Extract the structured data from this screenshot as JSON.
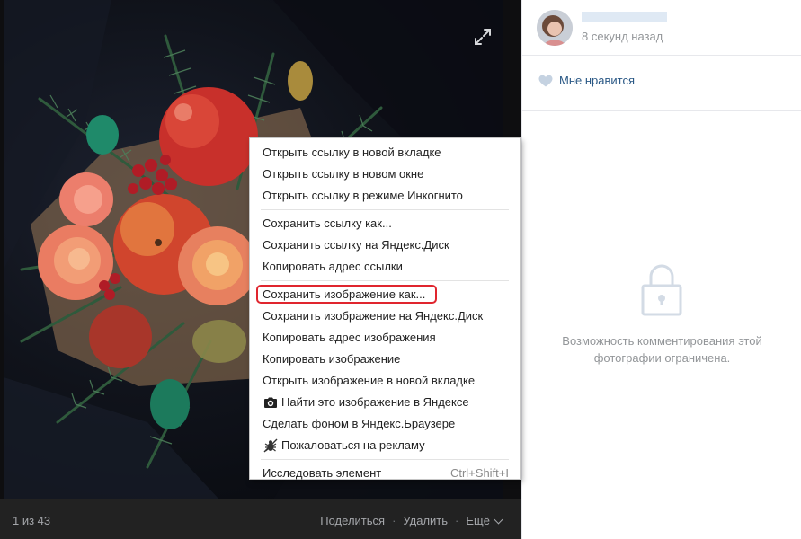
{
  "viewer": {
    "counter": "1 из 43",
    "actions": {
      "share": "Поделиться",
      "delete": "Удалить",
      "more": "Ещё"
    },
    "expand_icon": "expand-icon"
  },
  "side": {
    "author_time": "8 секунд назад",
    "like_label": "Мне нравится",
    "comments_closed_text": "Возможность комментирования этой фотографии ограничена."
  },
  "context_menu": {
    "items": [
      {
        "label": "Открыть ссылку в новой вкладке"
      },
      {
        "label": "Открыть ссылку в новом окне"
      },
      {
        "label": "Открыть ссылку в режиме Инкогнито"
      },
      {
        "label": "Сохранить ссылку как..."
      },
      {
        "label": "Сохранить ссылку на Яндекс.Диск"
      },
      {
        "label": "Копировать адрес ссылки"
      },
      {
        "label": "Сохранить изображение как..."
      },
      {
        "label": "Сохранить изображение на Яндекс.Диск"
      },
      {
        "label": "Копировать адрес изображения"
      },
      {
        "label": "Копировать изображение"
      },
      {
        "label": "Открыть изображение в новой вкладке"
      },
      {
        "label": "Найти это изображение в Яндексе",
        "icon": "camera-icon"
      },
      {
        "label": "Сделать фоном в Яндекс.Браузере"
      },
      {
        "label": "Пожаловаться на рекламу",
        "icon": "bug-icon"
      },
      {
        "label": "Исследовать элемент",
        "shortcut": "Ctrl+Shift+I"
      }
    ],
    "highlighted_item": "Сохранить изображение как..."
  },
  "colors": {
    "accent_link": "#2a5885",
    "highlight": "#e0252e",
    "muted": "#939699"
  }
}
